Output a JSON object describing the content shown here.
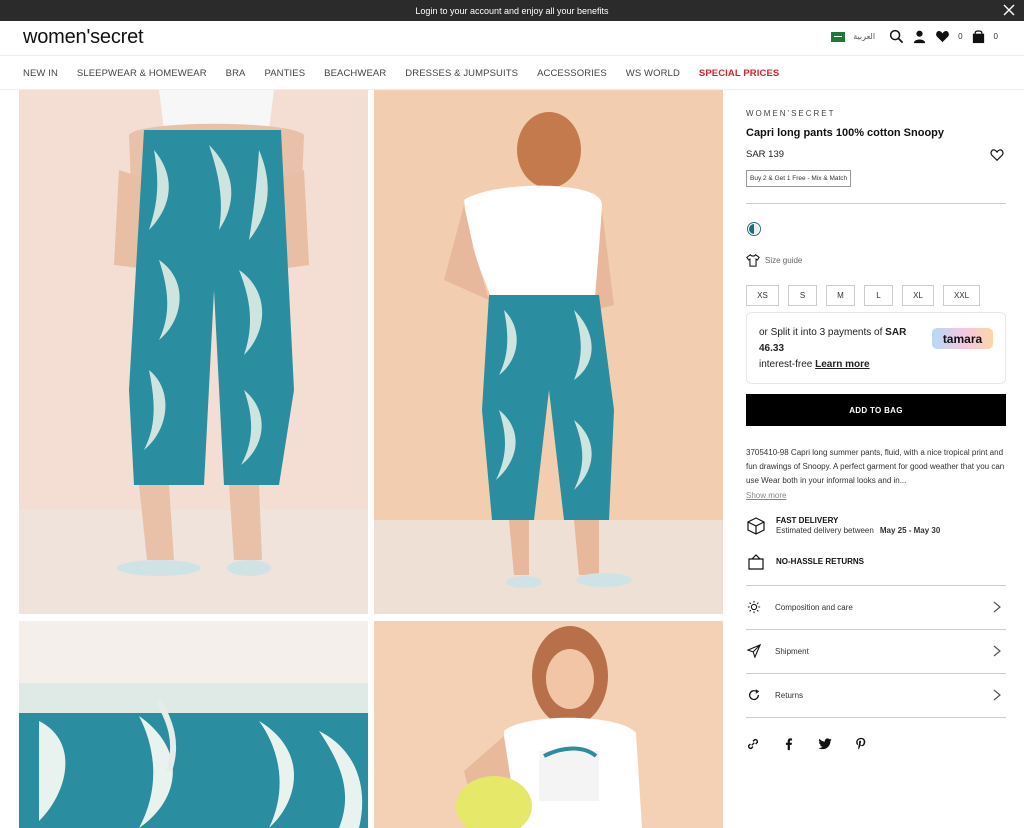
{
  "announcement": {
    "text": "Login to your account and enjoy all your benefits"
  },
  "header": {
    "logo": "women'secret",
    "language": "العربية",
    "wishlist_count": "0",
    "bag_count": "0"
  },
  "nav": {
    "items": [
      "NEW IN",
      "SLEEPWEAR & HOMEWEAR",
      "BRA",
      "PANTIES",
      "BEACHWEAR",
      "DRESSES & JUMPSUITS",
      "ACCESSORIES",
      "WS WORLD"
    ],
    "special": "SPECIAL PRICES"
  },
  "product": {
    "brand": "WOMEN'SECRET",
    "name": "Capri long pants 100% cotton Snoopy",
    "price": "SAR 139",
    "promo": "Buy 2 & Get 1 Free - Mix & Match",
    "size_guide": "Size guide",
    "sizes": [
      "XS",
      "S",
      "M",
      "L",
      "XL",
      "XXL"
    ],
    "tamara": {
      "line1": "or Split it into 3 payments of ",
      "amount_prefix": "SAR",
      "amount": "46.33",
      "line3": "interest-free ",
      "learn_more": "Learn more",
      "logo": "tamara"
    },
    "add_to_bag": "ADD TO BAG",
    "description": "3705410-98 Capri long summer pants, fluid, with a nice tropical print and fun drawings of Snoopy. A perfect garment for good weather that you can use Wear both in your informal looks and in...",
    "show_more": "Show more",
    "delivery": {
      "title": "FAST DELIVERY",
      "sub": "Estimated delivery between",
      "dates": "May 25 - May 30"
    },
    "returns_badge": "NO-HASSLE RETURNS",
    "accordion": [
      "Composition and care",
      "Shipment",
      "Returns"
    ]
  }
}
